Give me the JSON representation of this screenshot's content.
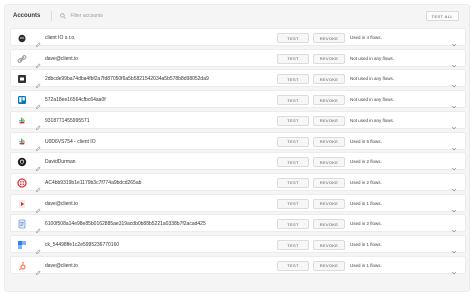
{
  "header": {
    "title": "Accounts",
    "search_placeholder": "Filter accounts",
    "test_all_label": "TEST ALL"
  },
  "accounts": [
    {
      "name": "client IO s.r.o.",
      "logo": "mailchimp-icon",
      "usage": "Used in 4 flows."
    },
    {
      "name": "dave@client.io",
      "logo": "link-icon",
      "usage": "Not used in any flows."
    },
    {
      "name": "2dbcde99ba74dba4fbf2a7fd87050f6a5b5821542034a5b578b8d98052da9",
      "logo": "square-icon",
      "usage": "Not used in any flows."
    },
    {
      "name": "572a18ee16564cfbc64aa0f",
      "logo": "trello-icon",
      "usage": "Not used in any flows."
    },
    {
      "name": "9318771455995571",
      "logo": "slack-icon",
      "usage": "Not used in any flows."
    },
    {
      "name": "U0D6VS754 - client IO",
      "logo": "slack-icon",
      "usage": "Used in 5 flows."
    },
    {
      "name": "DavidDurman",
      "logo": "github-icon",
      "usage": "Used in 2 flows."
    },
    {
      "name": "AC4bb9319b1e1179b3c7f774a9bdcd265ab",
      "logo": "twilio-icon",
      "usage": "Used in 2 flows."
    },
    {
      "name": "dave@client.io",
      "logo": "youtube-icon",
      "usage": "Used in 1 flows."
    },
    {
      "name": "6100f508a14e98e85b0162885ae319acdb0b88b5221a0338b7f2acad425",
      "logo": "doc-icon",
      "usage": "Used in 2 flows."
    },
    {
      "name": "ck_54498ffe1c2e5995236770160",
      "logo": "flow-icon",
      "usage": "Used in 1 flows."
    },
    {
      "name": "dave@client.io",
      "logo": "hubspot-icon",
      "usage": "Used in 1 flows."
    }
  ],
  "buttons": {
    "test": "TEST",
    "revoke": "REVOKE"
  },
  "colors": {
    "mailchimp": "#2b2b2b",
    "link": "#9a9a9a",
    "square": "#333333",
    "trello": "#0079bf",
    "slack": "#e01e5a",
    "github": "#222222",
    "twilio": "#e8323b",
    "youtube": "#c4302b",
    "doc": "#3a6fd8",
    "flow": "#2d7ff9",
    "hubspot": "#ff7a59"
  }
}
